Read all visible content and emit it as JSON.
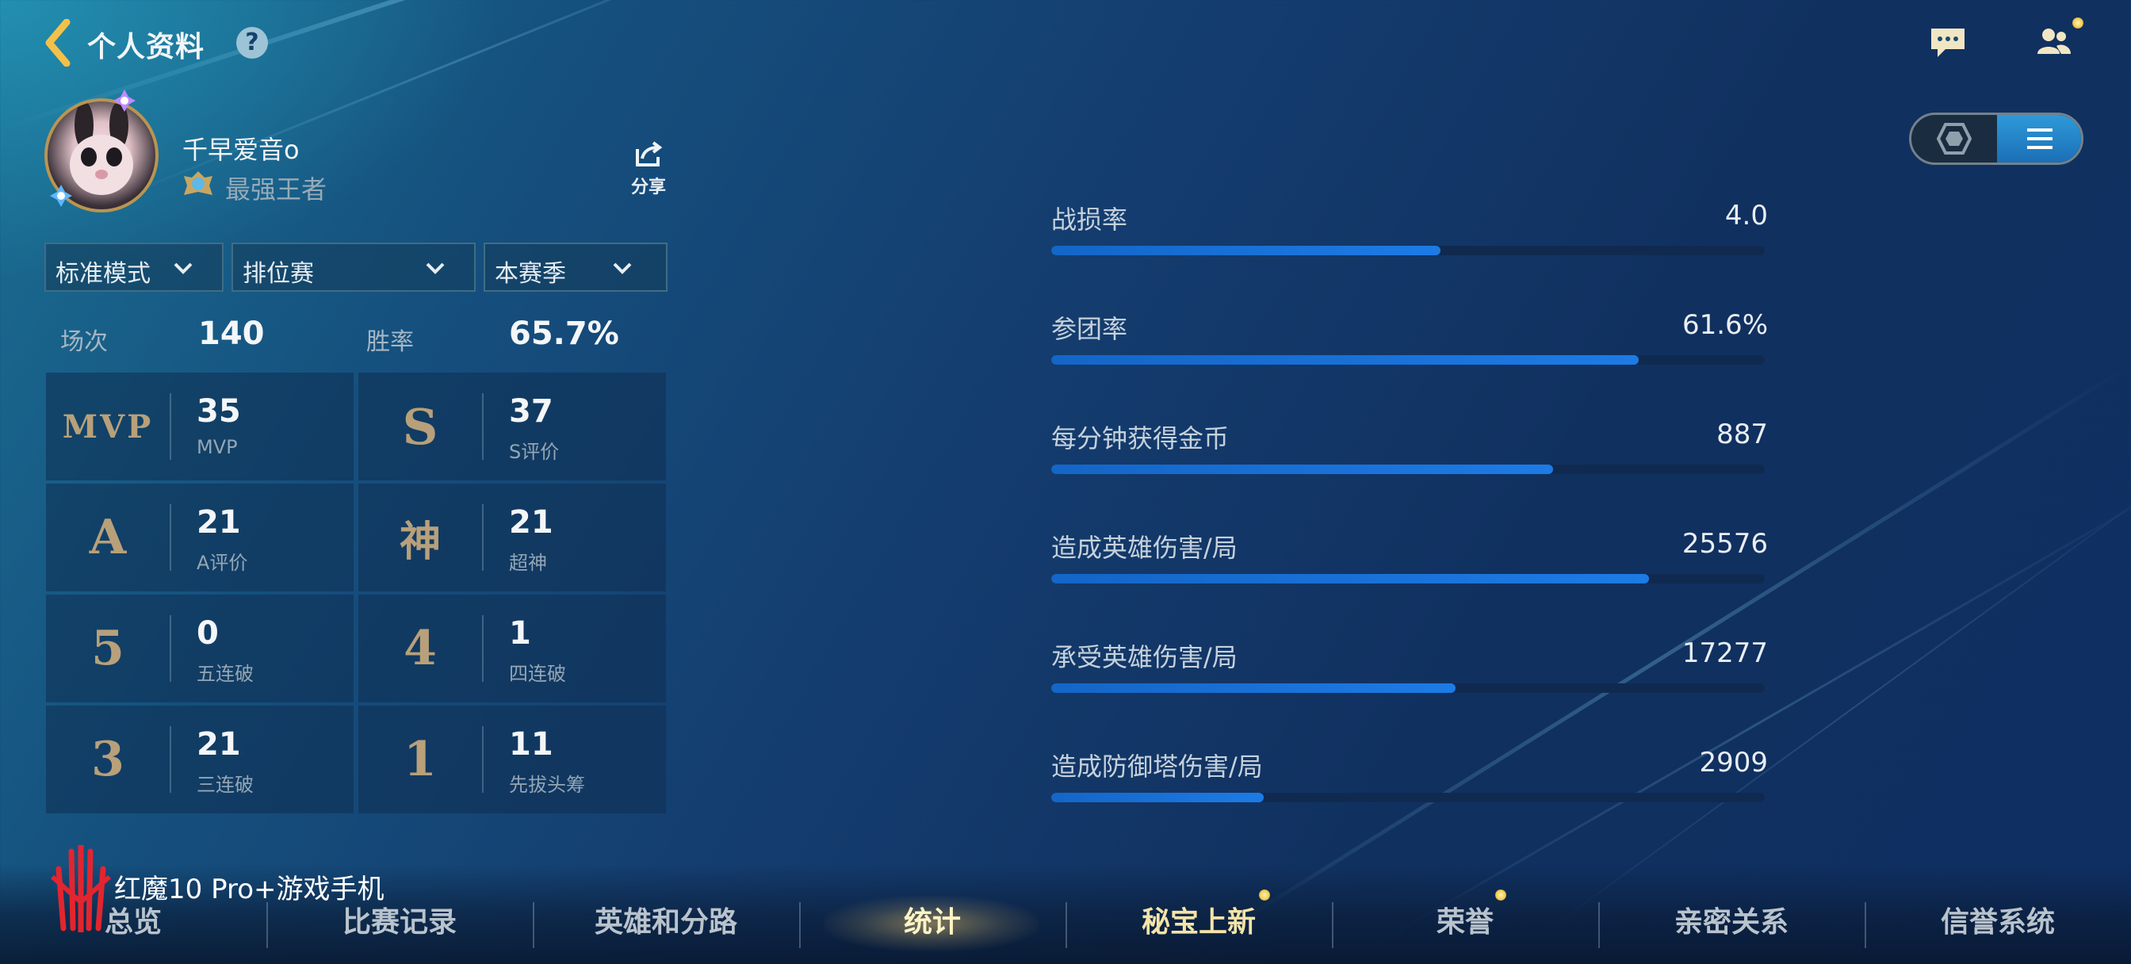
{
  "header": {
    "title": "个人资料",
    "help": "?"
  },
  "profile": {
    "name": "千早爱音o",
    "rank": "最强王者",
    "share_label": "分享"
  },
  "filters": [
    {
      "label": "标准模式"
    },
    {
      "label": "排位赛"
    },
    {
      "label": "本赛季"
    }
  ],
  "summary": {
    "games_label": "场次",
    "games_value": "140",
    "winrate_label": "胜率",
    "winrate_value": "65.7%"
  },
  "grid": [
    {
      "icon": "MVP",
      "value": "35",
      "caption": "MVP"
    },
    {
      "icon": "S",
      "value": "37",
      "caption": "S评价"
    },
    {
      "icon": "A",
      "value": "21",
      "caption": "A评价"
    },
    {
      "icon": "神",
      "value": "21",
      "caption": "超神"
    },
    {
      "icon": "5",
      "value": "0",
      "caption": "五连破"
    },
    {
      "icon": "4",
      "value": "1",
      "caption": "四连破"
    },
    {
      "icon": "3",
      "value": "21",
      "caption": "三连破"
    },
    {
      "icon": "1",
      "value": "11",
      "caption": "先拔头筹"
    }
  ],
  "stats": [
    {
      "name": "战损率",
      "value": "4.0",
      "fill": 0.545
    },
    {
      "name": "参团率",
      "value": "61.6%",
      "fill": 0.823
    },
    {
      "name": "每分钟获得金币",
      "value": "887",
      "fill": 0.703
    },
    {
      "name": "造成英雄伤害/局",
      "value": "25576",
      "fill": 0.838
    },
    {
      "name": "承受英雄伤害/局",
      "value": "17277",
      "fill": 0.567
    },
    {
      "name": "造成防御塔伤害/局",
      "value": "2909",
      "fill": 0.298
    }
  ],
  "nav": {
    "tabs": [
      "总览",
      "比赛记录",
      "英雄和分路",
      "统计",
      "秘宝上新",
      "荣誉",
      "亲密关系",
      "信誉系统"
    ],
    "active": "统计"
  },
  "watermark": {
    "text": "红魔10 Pro+游戏手机"
  },
  "side_id": "10568278",
  "colors": {
    "accent": "#1d7be6",
    "gold": "#b8a07a",
    "track": "#102a4f"
  }
}
